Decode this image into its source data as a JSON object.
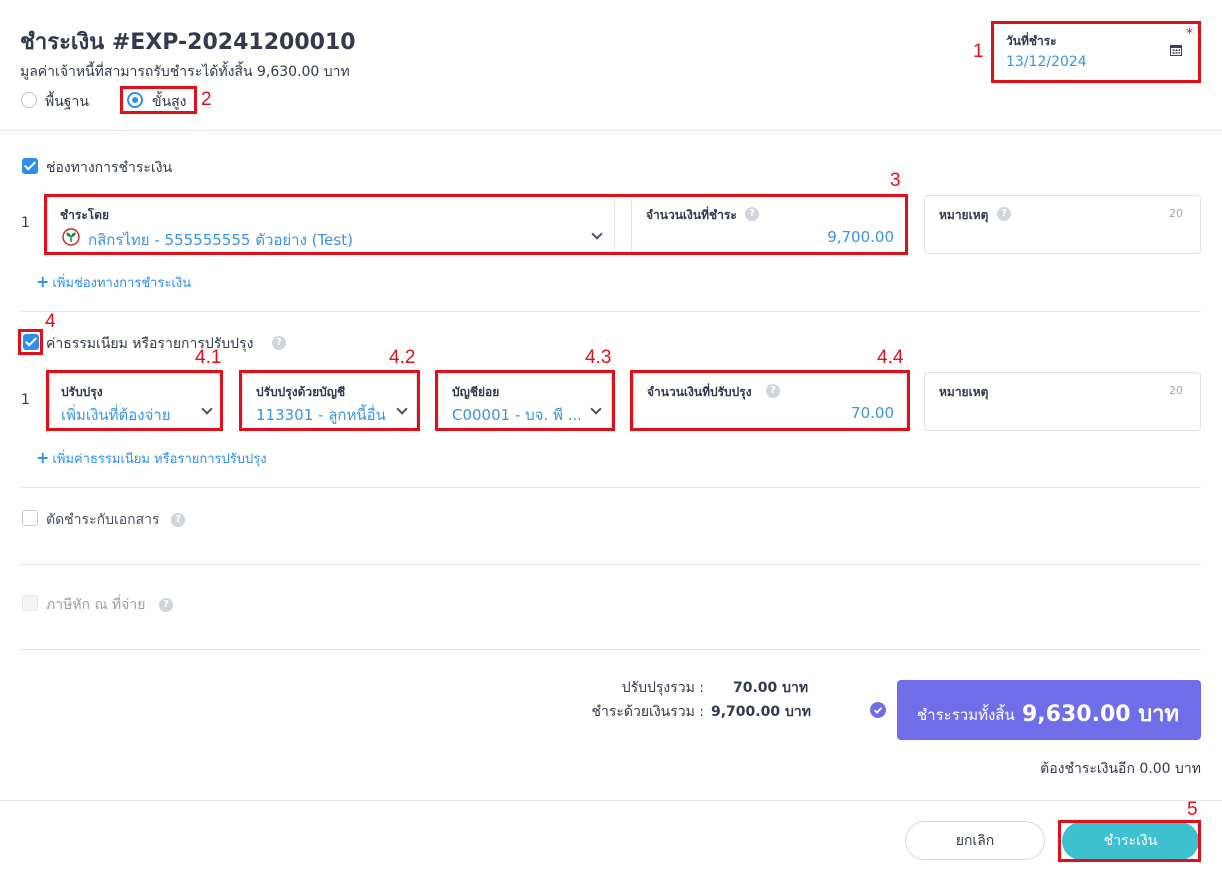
{
  "header": {
    "title": "ชำระเงิน #EXP-20241200010",
    "subtitle": "มูลค่าเจ้าหนี้ที่สามารถรับชำระได้ทั้งสิ้น 9,630.00 บาท",
    "mode_basic": "พื้นฐาน",
    "mode_advanced": "ขั้นสูง",
    "selected_mode": "ขั้นสูง",
    "date_label": "วันที่ชำระ",
    "date_required_mark": "*",
    "date_value": "13/12/2024"
  },
  "payment_channels": {
    "section_label": "ช่องทางการชำระเงิน",
    "checked": true,
    "rows": [
      {
        "index": "1",
        "paid_by_label": "ชำระโดย",
        "paid_by_value": "กสิกรไทย - 555555555 ตัวอย่าง (Test)",
        "amount_label": "จำนวนเงินที่ชำระ",
        "amount_value": "9,700.00",
        "note_label": "หมายเหตุ",
        "note_counter": "20"
      }
    ],
    "add_link": "เพิ่มช่องทางการชำระเงิน"
  },
  "fees": {
    "section_label": "ค่าธรรมเนียม หรือรายการปรับปรุง",
    "checked": true,
    "rows": [
      {
        "index": "1",
        "adjust_label": "ปรับปรุง",
        "adjust_value": "เพิ่มเงินที่ต้องจ่าย",
        "account_label": "ปรับปรุงด้วยบัญชี",
        "account_value": "113301 - ลูกหนี้อื่น",
        "subaccount_label": "บัญชีย่อย",
        "subaccount_value": "C00001 - บจ. พี ...",
        "amount_label": "จำนวนเงินที่ปรับปรุง",
        "amount_value": "70.00",
        "note_label": "หมายเหตุ",
        "note_counter": "20"
      }
    ],
    "add_link": "เพิ่มค่าธรรมเนียม หรือรายการปรับปรุง"
  },
  "offset": {
    "label": "ตัดชำระกับเอกสาร",
    "checked": false
  },
  "withholding": {
    "label": "ภาษีหัก ณ ที่จ่าย",
    "checked": false,
    "disabled": true
  },
  "summary": {
    "adjust_total_label": "ปรับปรุงรวม :",
    "adjust_total_value": "70.00 บาท",
    "paid_total_label": "ชำระด้วยเงินรวม :",
    "paid_total_value": "9,700.00 บาท",
    "grand_label": "ชำระรวมทั้งสิ้น",
    "grand_value": "9,630.00 บาท",
    "remaining": "ต้องชำระเงินอีก 0.00 บาท"
  },
  "footer": {
    "cancel_label": "ยกเลิก",
    "pay_label": "ชำระเงิน"
  },
  "annotations": [
    "1",
    "2",
    "3",
    "4",
    "4.1",
    "4.2",
    "4.3",
    "4.4",
    "5"
  ],
  "colors": {
    "accent_blue": "#2f8fe8",
    "value_blue": "#3a94e0",
    "highlight_red": "#e0101a",
    "total_purple": "#6f6de8",
    "pay_teal": "#3dc0cf"
  }
}
